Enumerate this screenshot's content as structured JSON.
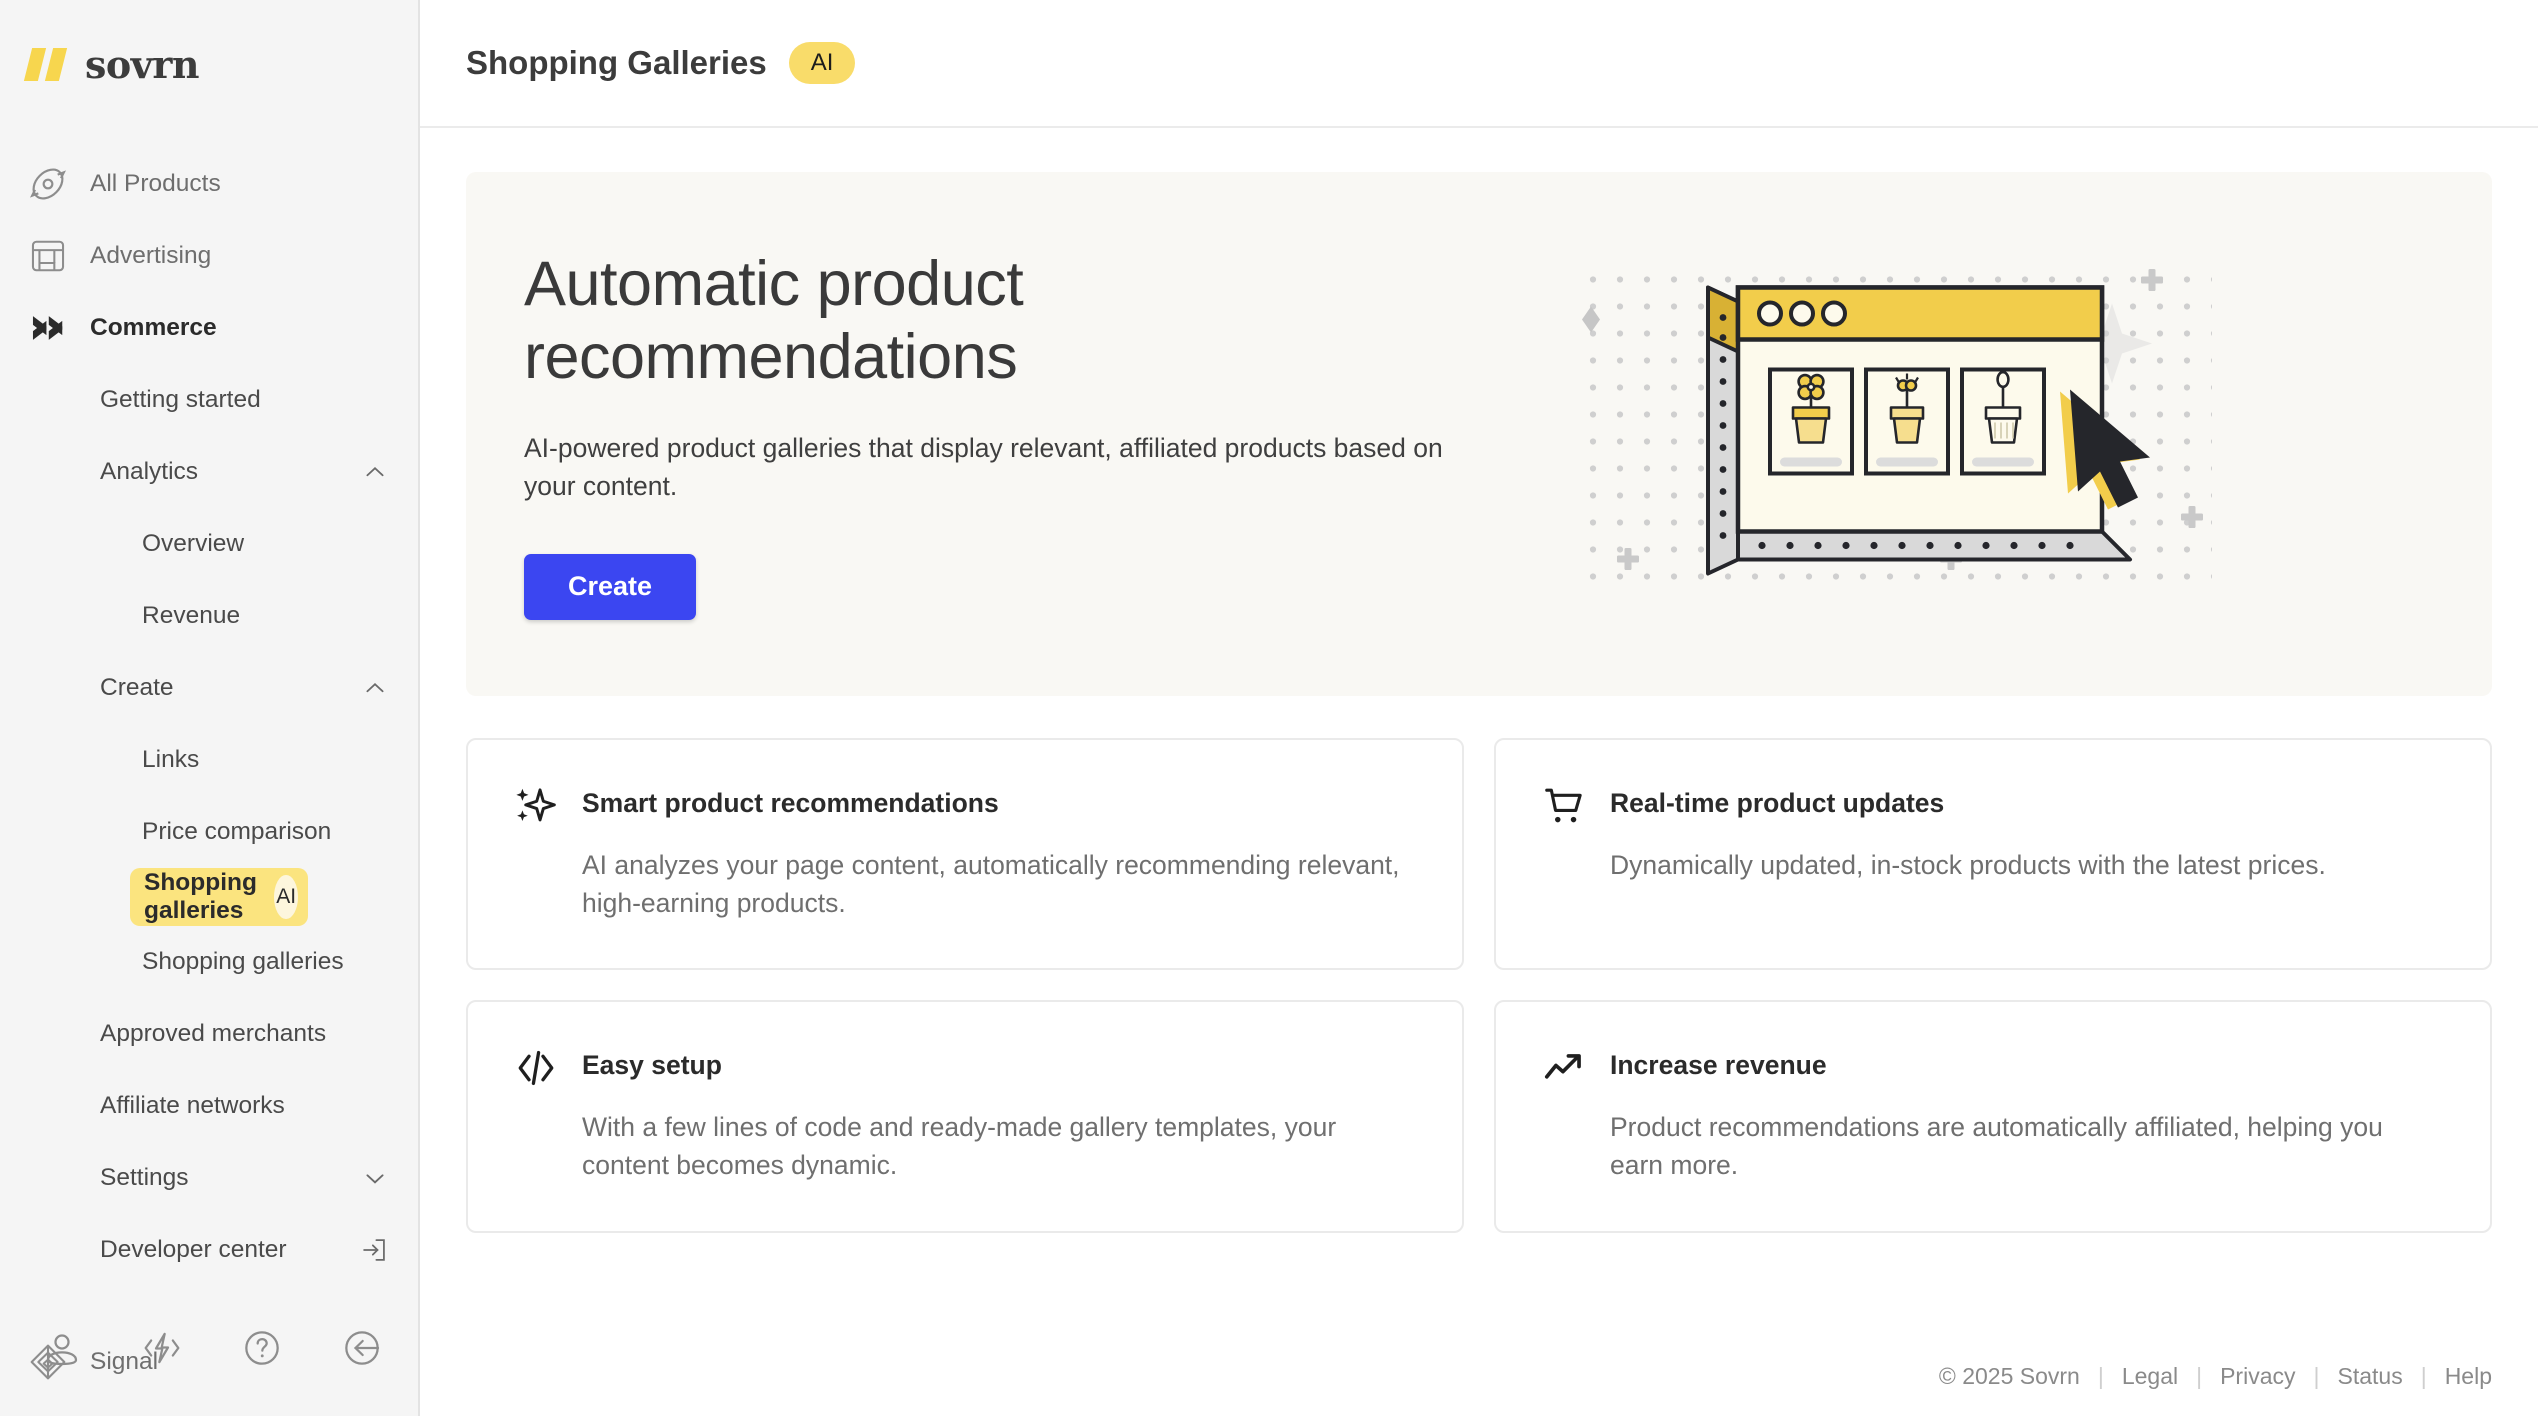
{
  "brand": {
    "name": "sovrn",
    "mark": "sovrn-logo-mark"
  },
  "sidebar": {
    "primary": [
      {
        "label": "All Products",
        "icon": "compass-icon",
        "active": false
      },
      {
        "label": "Advertising",
        "icon": "layout-panels-icon",
        "active": false
      },
      {
        "label": "Commerce",
        "icon": "double-chevron-right-icon",
        "active": true
      }
    ],
    "commerce_items": [
      {
        "label": "Getting started",
        "type": "link"
      },
      {
        "label": "Analytics",
        "type": "group",
        "chevron": "chevron-up-icon"
      },
      {
        "label": "Overview",
        "type": "sublink"
      },
      {
        "label": "Revenue",
        "type": "sublink"
      },
      {
        "label": "Create",
        "type": "group",
        "chevron": "chevron-up-icon"
      },
      {
        "label": "Links",
        "type": "sublink"
      },
      {
        "label": "Price comparison",
        "type": "sublink"
      },
      {
        "label": "Shopping galleries",
        "type": "sublink",
        "selected": true,
        "badge": "AI"
      },
      {
        "label": "Shopping galleries",
        "type": "sublink"
      },
      {
        "label": "Approved merchants",
        "type": "link"
      },
      {
        "label": "Affiliate networks",
        "type": "link"
      },
      {
        "label": "Settings",
        "type": "group",
        "chevron": "chevron-down-icon"
      },
      {
        "label": "Developer center",
        "type": "link",
        "trailing_icon": "external-link-icon"
      }
    ],
    "signal": {
      "label": "Signal",
      "icon": "signal-diamond-icon"
    },
    "bottom_icons": [
      {
        "name": "user-account-icon"
      },
      {
        "name": "code-lightning-icon"
      },
      {
        "name": "help-question-icon"
      },
      {
        "name": "collapse-sidebar-icon"
      }
    ]
  },
  "header": {
    "title": "Shopping Galleries",
    "badge": "AI"
  },
  "hero": {
    "heading": "Automatic product recommendations",
    "description": "AI-powered product galleries that display relevant, affiliated products based on your content.",
    "cta_label": "Create",
    "illustration": "browser-window-product-gallery-cursor-illustration"
  },
  "cards": [
    {
      "icon": "sparkle-ai-icon",
      "title": "Smart product recommendations",
      "body": "AI analyzes your page content, automatically recommending relevant, high-earning products."
    },
    {
      "icon": "shopping-cart-icon",
      "title": "Real-time product updates",
      "body": "Dynamically updated, in-stock products with the latest prices."
    },
    {
      "icon": "code-brackets-icon",
      "title": "Easy setup",
      "body": "With a few lines of code and ready-made gallery templates, your content becomes dynamic."
    },
    {
      "icon": "trending-up-arrow-icon",
      "title": "Increase revenue",
      "body": "Product recommendations are automatically affiliated, helping you earn more."
    }
  ],
  "footer": {
    "copyright": "© 2025 Sovrn",
    "links": [
      "Legal",
      "Privacy",
      "Status",
      "Help"
    ]
  },
  "colors": {
    "brand_yellow": "#f7d64e",
    "badge_yellow": "#f9dc6a",
    "selected_yellow": "#fbe47f",
    "accent_blue": "#3b46f1",
    "hero_bg": "#f9f8f4",
    "sidebar_bg": "#f5f5f5"
  }
}
